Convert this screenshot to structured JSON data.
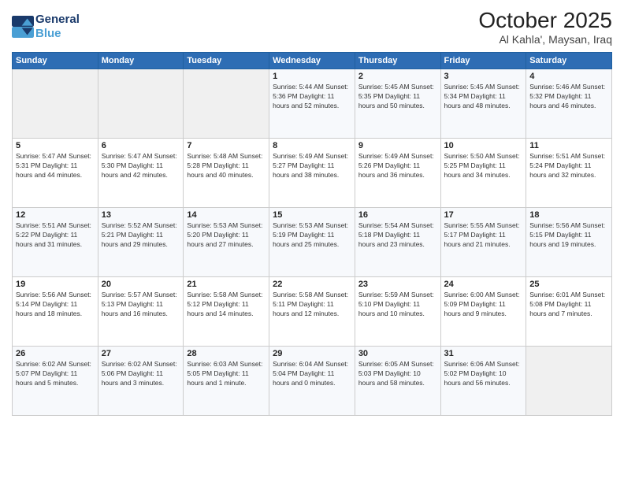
{
  "logo": {
    "line1": "General",
    "line2": "Blue"
  },
  "title": "October 2025",
  "subtitle": "Al Kahla', Maysan, Iraq",
  "weekdays": [
    "Sunday",
    "Monday",
    "Tuesday",
    "Wednesday",
    "Thursday",
    "Friday",
    "Saturday"
  ],
  "days": [
    {
      "date": "",
      "info": ""
    },
    {
      "date": "",
      "info": ""
    },
    {
      "date": "",
      "info": ""
    },
    {
      "date": "1",
      "info": "Sunrise: 5:44 AM\nSunset: 5:36 PM\nDaylight: 11 hours\nand 52 minutes."
    },
    {
      "date": "2",
      "info": "Sunrise: 5:45 AM\nSunset: 5:35 PM\nDaylight: 11 hours\nand 50 minutes."
    },
    {
      "date": "3",
      "info": "Sunrise: 5:45 AM\nSunset: 5:34 PM\nDaylight: 11 hours\nand 48 minutes."
    },
    {
      "date": "4",
      "info": "Sunrise: 5:46 AM\nSunset: 5:32 PM\nDaylight: 11 hours\nand 46 minutes."
    },
    {
      "date": "5",
      "info": "Sunrise: 5:47 AM\nSunset: 5:31 PM\nDaylight: 11 hours\nand 44 minutes."
    },
    {
      "date": "6",
      "info": "Sunrise: 5:47 AM\nSunset: 5:30 PM\nDaylight: 11 hours\nand 42 minutes."
    },
    {
      "date": "7",
      "info": "Sunrise: 5:48 AM\nSunset: 5:28 PM\nDaylight: 11 hours\nand 40 minutes."
    },
    {
      "date": "8",
      "info": "Sunrise: 5:49 AM\nSunset: 5:27 PM\nDaylight: 11 hours\nand 38 minutes."
    },
    {
      "date": "9",
      "info": "Sunrise: 5:49 AM\nSunset: 5:26 PM\nDaylight: 11 hours\nand 36 minutes."
    },
    {
      "date": "10",
      "info": "Sunrise: 5:50 AM\nSunset: 5:25 PM\nDaylight: 11 hours\nand 34 minutes."
    },
    {
      "date": "11",
      "info": "Sunrise: 5:51 AM\nSunset: 5:24 PM\nDaylight: 11 hours\nand 32 minutes."
    },
    {
      "date": "12",
      "info": "Sunrise: 5:51 AM\nSunset: 5:22 PM\nDaylight: 11 hours\nand 31 minutes."
    },
    {
      "date": "13",
      "info": "Sunrise: 5:52 AM\nSunset: 5:21 PM\nDaylight: 11 hours\nand 29 minutes."
    },
    {
      "date": "14",
      "info": "Sunrise: 5:53 AM\nSunset: 5:20 PM\nDaylight: 11 hours\nand 27 minutes."
    },
    {
      "date": "15",
      "info": "Sunrise: 5:53 AM\nSunset: 5:19 PM\nDaylight: 11 hours\nand 25 minutes."
    },
    {
      "date": "16",
      "info": "Sunrise: 5:54 AM\nSunset: 5:18 PM\nDaylight: 11 hours\nand 23 minutes."
    },
    {
      "date": "17",
      "info": "Sunrise: 5:55 AM\nSunset: 5:17 PM\nDaylight: 11 hours\nand 21 minutes."
    },
    {
      "date": "18",
      "info": "Sunrise: 5:56 AM\nSunset: 5:15 PM\nDaylight: 11 hours\nand 19 minutes."
    },
    {
      "date": "19",
      "info": "Sunrise: 5:56 AM\nSunset: 5:14 PM\nDaylight: 11 hours\nand 18 minutes."
    },
    {
      "date": "20",
      "info": "Sunrise: 5:57 AM\nSunset: 5:13 PM\nDaylight: 11 hours\nand 16 minutes."
    },
    {
      "date": "21",
      "info": "Sunrise: 5:58 AM\nSunset: 5:12 PM\nDaylight: 11 hours\nand 14 minutes."
    },
    {
      "date": "22",
      "info": "Sunrise: 5:58 AM\nSunset: 5:11 PM\nDaylight: 11 hours\nand 12 minutes."
    },
    {
      "date": "23",
      "info": "Sunrise: 5:59 AM\nSunset: 5:10 PM\nDaylight: 11 hours\nand 10 minutes."
    },
    {
      "date": "24",
      "info": "Sunrise: 6:00 AM\nSunset: 5:09 PM\nDaylight: 11 hours\nand 9 minutes."
    },
    {
      "date": "25",
      "info": "Sunrise: 6:01 AM\nSunset: 5:08 PM\nDaylight: 11 hours\nand 7 minutes."
    },
    {
      "date": "26",
      "info": "Sunrise: 6:02 AM\nSunset: 5:07 PM\nDaylight: 11 hours\nand 5 minutes."
    },
    {
      "date": "27",
      "info": "Sunrise: 6:02 AM\nSunset: 5:06 PM\nDaylight: 11 hours\nand 3 minutes."
    },
    {
      "date": "28",
      "info": "Sunrise: 6:03 AM\nSunset: 5:05 PM\nDaylight: 11 hours\nand 1 minute."
    },
    {
      "date": "29",
      "info": "Sunrise: 6:04 AM\nSunset: 5:04 PM\nDaylight: 11 hours\nand 0 minutes."
    },
    {
      "date": "30",
      "info": "Sunrise: 6:05 AM\nSunset: 5:03 PM\nDaylight: 10 hours\nand 58 minutes."
    },
    {
      "date": "31",
      "info": "Sunrise: 6:06 AM\nSunset: 5:02 PM\nDaylight: 10 hours\nand 56 minutes."
    },
    {
      "date": "",
      "info": ""
    }
  ]
}
